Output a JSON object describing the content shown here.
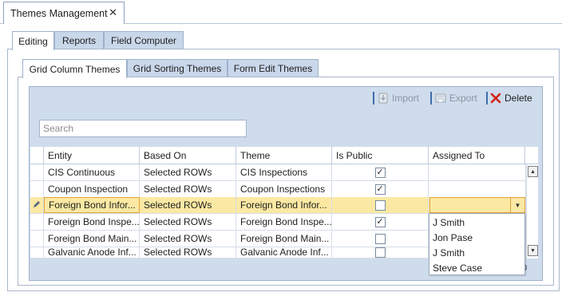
{
  "document_tab": {
    "title": "Themes Management",
    "close_glyph": "✕"
  },
  "level1_tabs": [
    {
      "label": "Editing",
      "active": true
    },
    {
      "label": "Reports",
      "active": false
    },
    {
      "label": "Field Computer",
      "active": false
    }
  ],
  "level2_tabs": [
    {
      "label": "Grid Column Themes",
      "active": true
    },
    {
      "label": "Grid Sorting Themes",
      "active": false
    },
    {
      "label": "Form Edit Themes",
      "active": false
    }
  ],
  "toolbar": {
    "import_label": "Import",
    "export_label": "Export",
    "delete_label": "Delete",
    "import_icon": "import-icon",
    "export_icon": "export-icon",
    "delete_icon": "delete-x-icon"
  },
  "search": {
    "placeholder": "Search",
    "value": ""
  },
  "grid": {
    "columns": [
      "Entity",
      "Based On",
      "Theme",
      "Is Public",
      "Assigned To"
    ],
    "rows": [
      {
        "entity": "CIS Continuous",
        "based_on": "Selected ROWs",
        "theme": "CIS Inspections",
        "is_public": true,
        "assigned_to": ""
      },
      {
        "entity": "Coupon Inspection",
        "based_on": "Selected ROWs",
        "theme": "Coupon Inspections",
        "is_public": true,
        "assigned_to": ""
      },
      {
        "entity": "Foreign Bond Infor...",
        "based_on": "Selected ROWs",
        "theme": "Foreign Bond Infor...",
        "is_public": false,
        "assigned_to": "",
        "selected": true
      },
      {
        "entity": "Foreign Bond Inspe...",
        "based_on": "Selected ROWs",
        "theme": "Foreign Bond Inspe...",
        "is_public": true,
        "assigned_to": ""
      },
      {
        "entity": "Foreign Bond Main...",
        "based_on": "Selected ROWs",
        "theme": "Foreign Bond Main...",
        "is_public": false,
        "assigned_to": ""
      },
      {
        "entity": "Galvanic Anode Inf...",
        "based_on": "Selected ROWs",
        "theme": "Galvanic Anode Inf...",
        "is_public": false,
        "assigned_to": ""
      }
    ]
  },
  "assigned_to_dropdown": {
    "options": [
      "J Smith",
      "Jon Pase",
      "J Smith",
      "Steve Case"
    ]
  },
  "pager_fragment": "0",
  "colors": {
    "frame_blue": "#cfdcec",
    "tab_blue": "#c9d7ea",
    "selected_row": "#fbe9a3",
    "selected_border": "#e4a23a",
    "delete_red": "#d0231b",
    "separator_blue": "#3d6ea8"
  }
}
